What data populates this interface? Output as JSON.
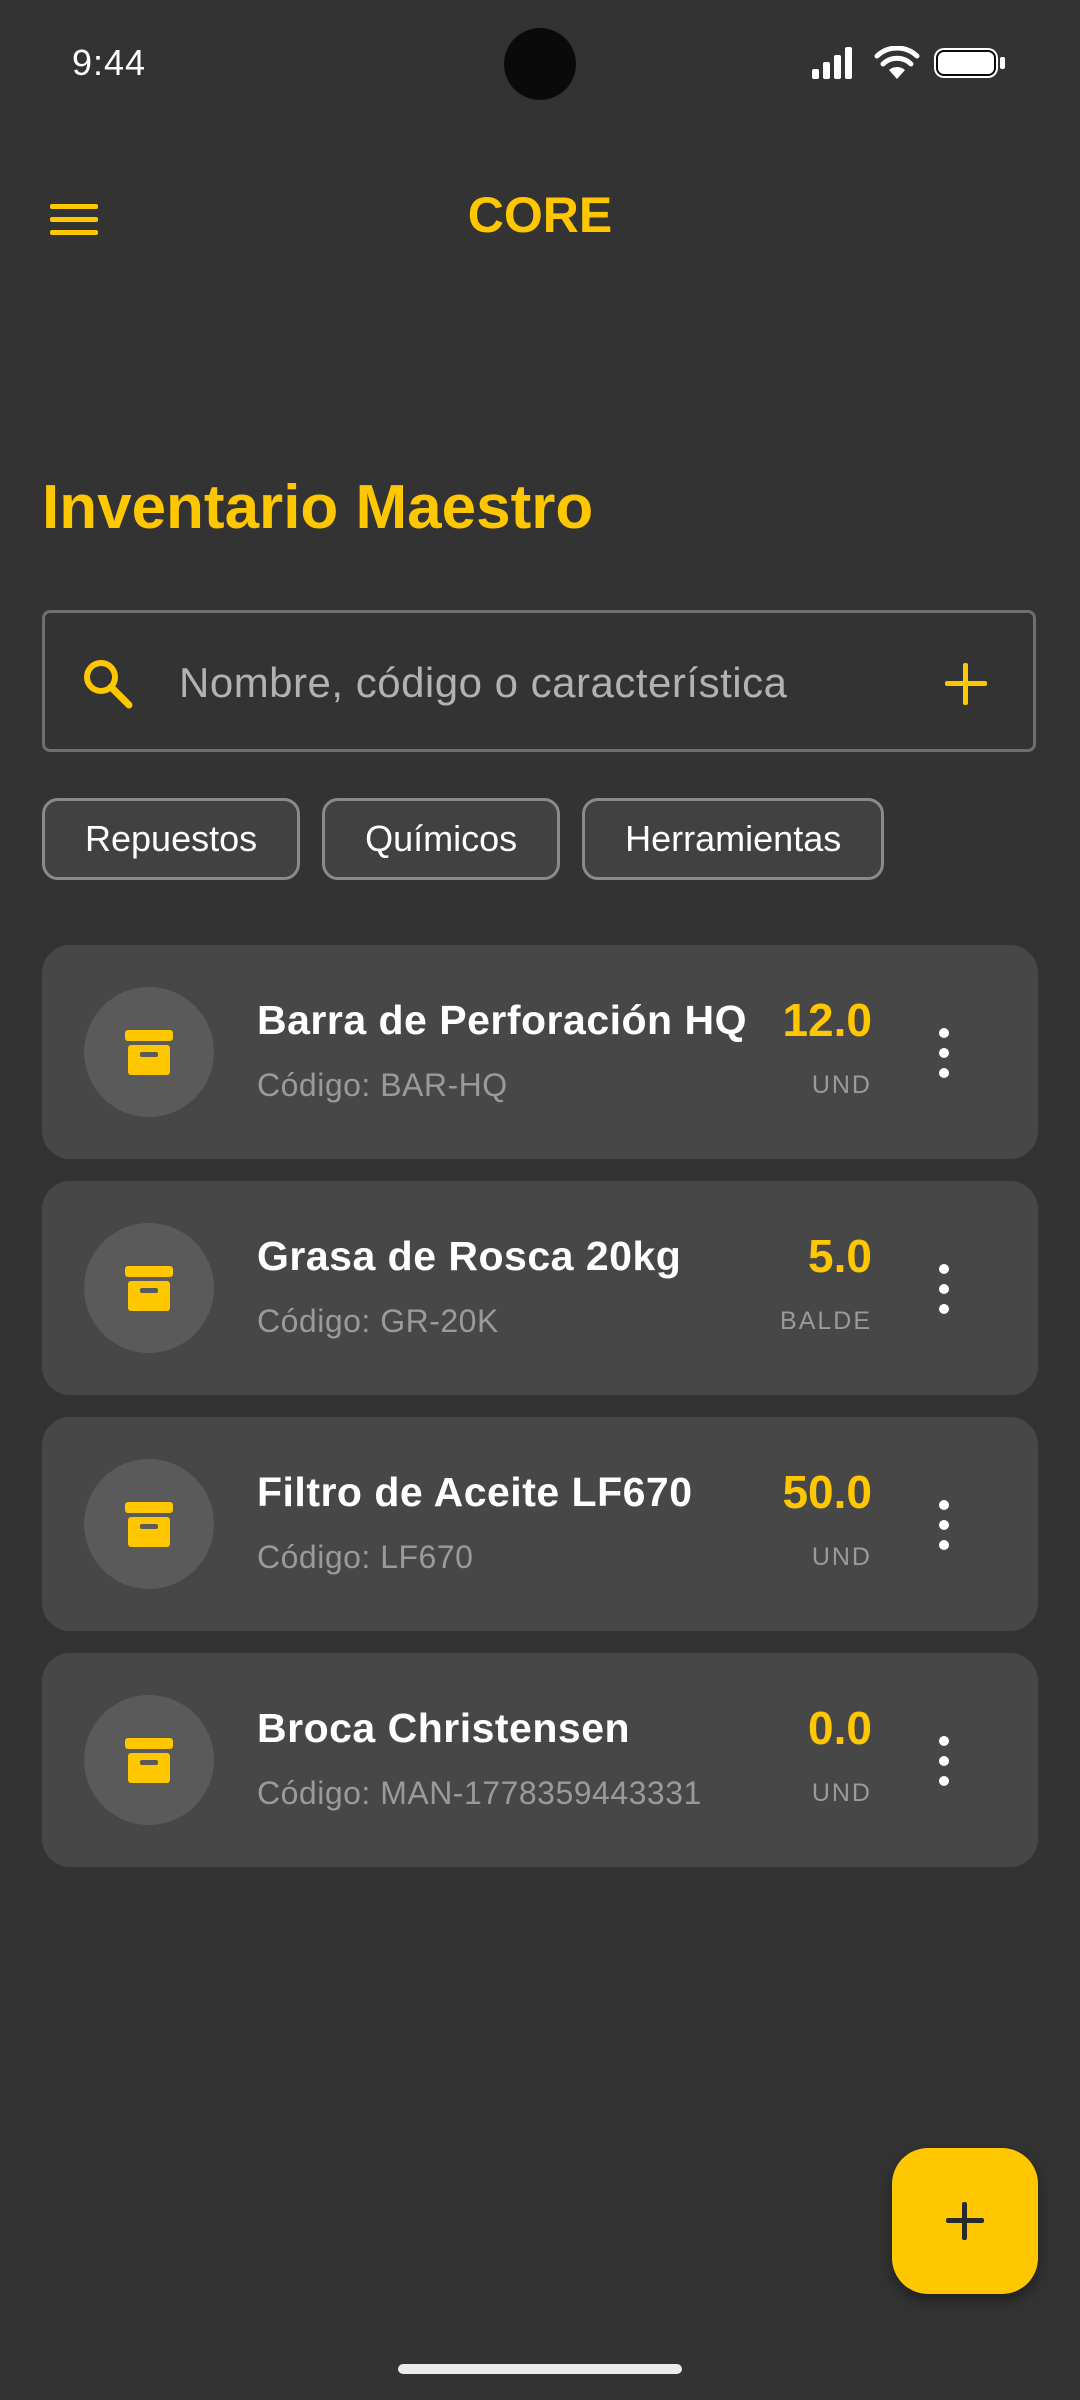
{
  "status_bar": {
    "time": "9:44"
  },
  "app_bar": {
    "title": "CORE",
    "menu_icon": "hamburger-menu-icon"
  },
  "page": {
    "title": "Inventario Maestro"
  },
  "search": {
    "placeholder": "Nombre, código o característica",
    "value": "",
    "icon": "search-icon",
    "add_icon": "plus-icon"
  },
  "filters": [
    {
      "label": "Repuestos"
    },
    {
      "label": "Químicos"
    },
    {
      "label": "Herramientas"
    }
  ],
  "inventory": [
    {
      "name": "Barra de Perforación HQ",
      "code": "Código: BAR-HQ",
      "quantity": "12.0",
      "unit": "UND",
      "icon": "archive-box-icon"
    },
    {
      "name": "Grasa de Rosca 20kg",
      "code": "Código: GR-20K",
      "quantity": "5.0",
      "unit": "BALDE",
      "icon": "archive-box-icon"
    },
    {
      "name": "Filtro de Aceite LF670",
      "code": "Código: LF670",
      "quantity": "50.0",
      "unit": "UND",
      "icon": "archive-box-icon"
    },
    {
      "name": "Broca Christensen",
      "code": "Código: MAN-1778359443331",
      "quantity": "0.0",
      "unit": "UND",
      "icon": "archive-box-icon"
    }
  ],
  "fab": {
    "icon": "plus-icon"
  },
  "colors": {
    "accent": "#FFC700",
    "background": "#333333",
    "card": "#474747"
  }
}
